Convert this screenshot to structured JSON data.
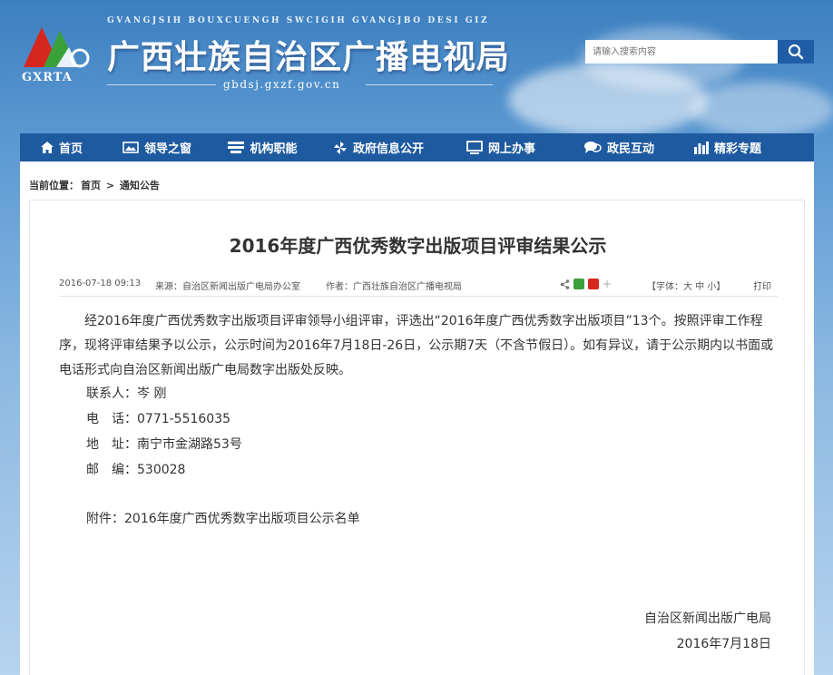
{
  "header": {
    "logo_text": "GXRTA",
    "pinyin": "GVANGJSIH BOUXCUENGH SWCIGIH  GVANGJBO DESI GIZ",
    "site_title": "广西壮族自治区广播电视局",
    "domain": "gbdsj.gxzf.gov.cn",
    "search_placeholder": "请输入搜索内容",
    "search_icon": "search-icon"
  },
  "nav": {
    "items": [
      {
        "label": "首页",
        "icon": "home-icon"
      },
      {
        "label": "领导之窗",
        "icon": "picture-icon"
      },
      {
        "label": "机构职能",
        "icon": "list-icon"
      },
      {
        "label": "政府信息公开",
        "icon": "pinwheel-icon"
      },
      {
        "label": "网上办事",
        "icon": "monitor-icon"
      },
      {
        "label": "政民互动",
        "icon": "chat-icon"
      },
      {
        "label": "精彩专题",
        "icon": "bar-chart-icon"
      }
    ]
  },
  "breadcrumb": {
    "prefix": "当前位置：",
    "home": "首页",
    "sep": " > ",
    "current": "通知公告"
  },
  "article": {
    "title": "2016年度广西优秀数字出版项目评审结果公示",
    "date": "2016-07-18 09:13",
    "source": "来源：自治区新闻出版广电局办公室",
    "author": "作者：广西壮族自治区广播电视局",
    "font_size_label": "【字体：大 中 小】",
    "print_label": "打印",
    "paragraph": "经2016年度广西优秀数字出版项目评审领导小组评审，评选出“2016年度广西优秀数字出版项目”13个。按照评审工作程序，现将评审结果予以公示，公示时间为2016年7月18日-26日，公示期7天（不含节假日）。如有异议，请于公示期内以书面或电话形式向自治区新闻出版广电局数字出版处反映。",
    "contact_person": "联系人：岑 刚",
    "phone": "电　话：0771-5516035",
    "address": "地　址：南宁市金湖路53号",
    "postcode": "邮　编：530028",
    "attachment": "附件：2016年度广西优秀数字出版项目公示名单",
    "signature_org": "自治区新闻出版广电局",
    "signature_date": "2016年7月18日"
  },
  "colors": {
    "nav_bg": "#1e5aa0",
    "search_button": "#1f5da6",
    "logo_green": "#3aa13a",
    "logo_red": "#d7261e"
  }
}
